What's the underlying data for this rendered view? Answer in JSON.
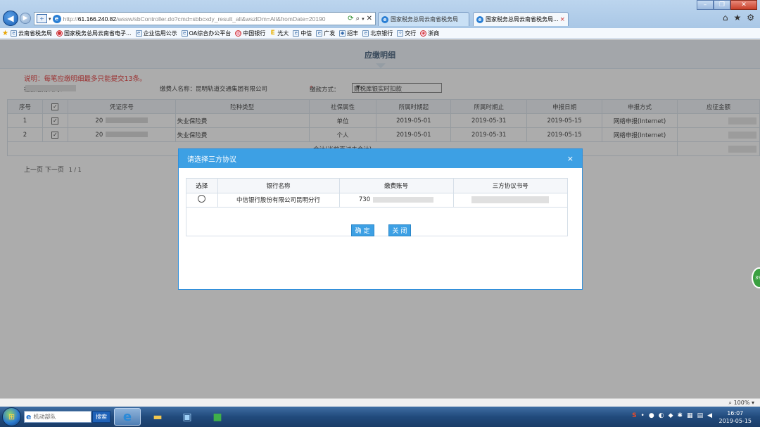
{
  "browser": {
    "url_prefix": "http://",
    "url_host": "61.166.240.82",
    "url_path": "/wssw/sbController.do?cmd=sbbcxdy_result_all&wszlDm=All&fromDate=20190",
    "tabs": [
      {
        "label": "国家税务总局云南省税务局"
      },
      {
        "label": "国家税务总局云南省税务局..."
      }
    ],
    "tab_close": "×",
    "favorites": [
      {
        "label": "云南省税务局"
      },
      {
        "label": "国家税务总局云南省电子..."
      },
      {
        "label": "企业信用公示"
      },
      {
        "label": "OA综合办公平台"
      },
      {
        "label": "中国银行"
      },
      {
        "label": "光大"
      },
      {
        "label": "中信"
      },
      {
        "label": "广发"
      },
      {
        "label": "招丰"
      },
      {
        "label": "北京银行"
      },
      {
        "label": "交行"
      },
      {
        "label": "浙商"
      }
    ],
    "zoom": "100%"
  },
  "page": {
    "title": "应缴明细",
    "note": "说明：每笔应缴明细最多只能提交13条。",
    "credit_label": "社会信用代码：F5",
    "payer_label": "缴费人名称：昆明轨道交通集团有限公司",
    "pay_method_label": "缴款方式：",
    "pay_method_value": "财税库银实时扣款",
    "table": {
      "headers": [
        "序号",
        "",
        "凭证序号",
        "险种类型",
        "社保属性",
        "所属时期起",
        "所属时期止",
        "申报日期",
        "申报方式",
        "应征金额"
      ],
      "rows": [
        {
          "no": "1",
          "voucher": "20",
          "type": "失业保险费",
          "attr": "单位",
          "start": "2019-05-01",
          "end": "2019-05-31",
          "date": "2019-05-15",
          "method": "网络申报(Internet)"
        },
        {
          "no": "2",
          "voucher": "20",
          "type": "失业保险费",
          "attr": "个人",
          "start": "2019-05-01",
          "end": "2019-05-31",
          "date": "2019-05-15",
          "method": "网络申报(Internet)"
        }
      ],
      "total_label": "合计(当前页过去合计)"
    },
    "pager": {
      "prev": "上一页",
      "next": "下一页",
      "page": "1 / 1"
    }
  },
  "dialog": {
    "title": "请选择三方协议",
    "close": "×",
    "headers": [
      "选择",
      "银行名称",
      "缴费账号",
      "三方协议书号"
    ],
    "rows": [
      {
        "bank": "中信银行股份有限公司昆明分行",
        "account": "730"
      }
    ],
    "confirm": "确 定",
    "cancel": "关 闭"
  },
  "taskbar": {
    "search_placeholder": "机动部队",
    "search_button": "搜索",
    "time": "16:07",
    "date": "2019-05-15"
  },
  "side_badge": "39"
}
